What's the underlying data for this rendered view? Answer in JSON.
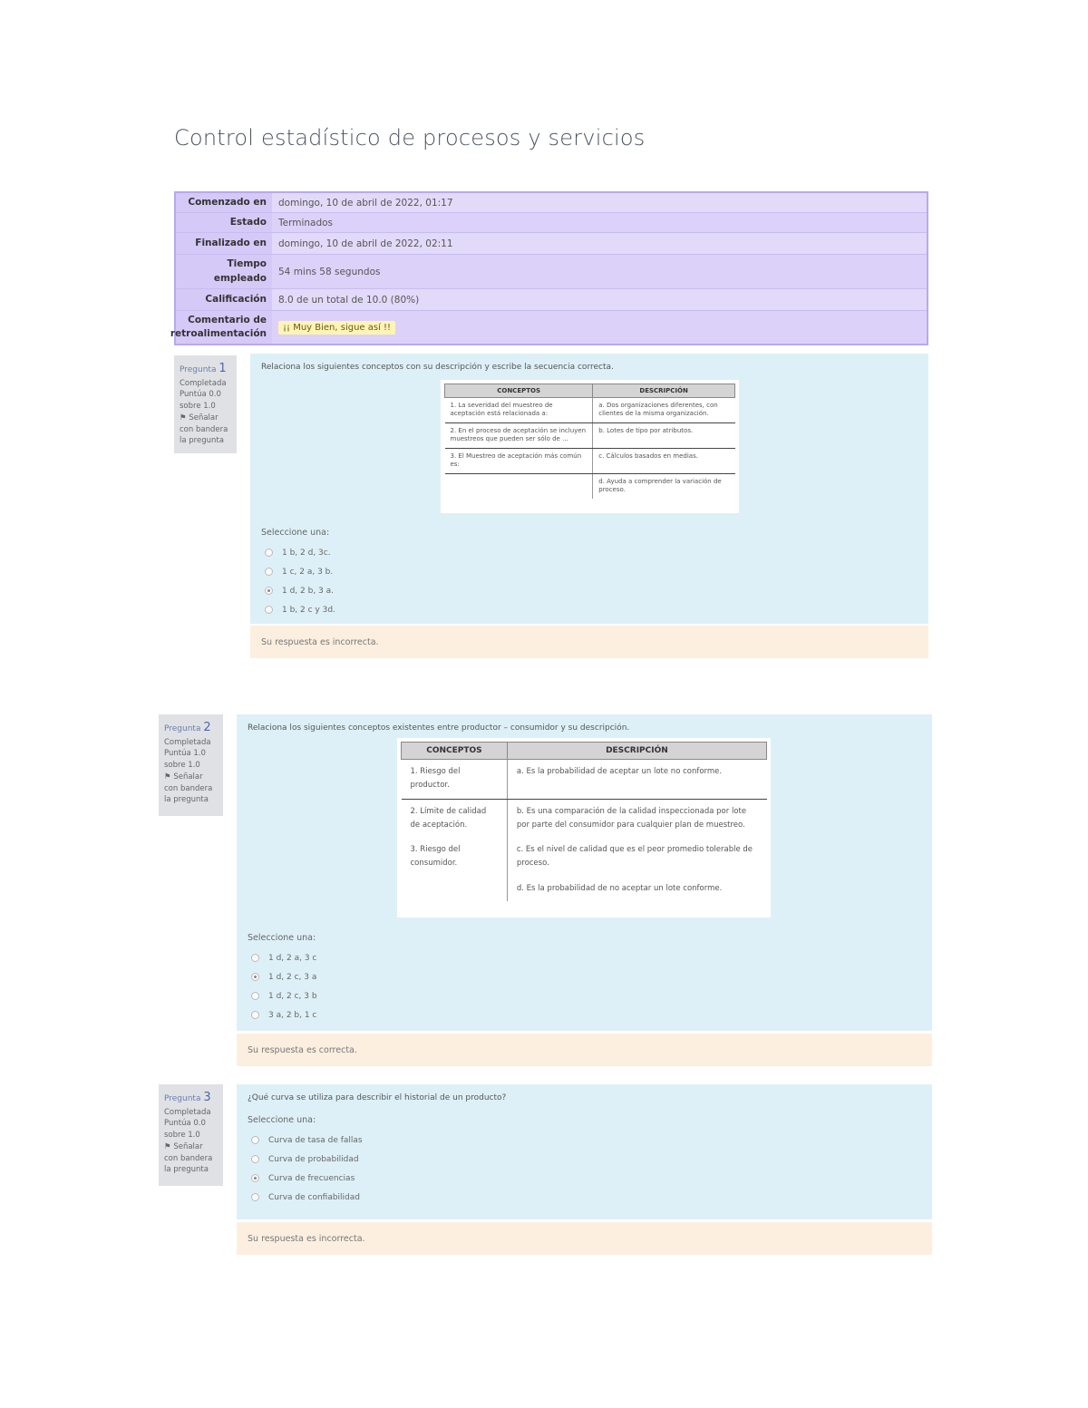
{
  "page_title": "Control estadístico de procesos y servicios",
  "summary": [
    {
      "label": "Comenzado en",
      "value": "domingo, 10 de abril de 2022, 01:17"
    },
    {
      "label": "Estado",
      "value": "Terminados"
    },
    {
      "label": "Finalizado en",
      "value": "domingo, 10 de abril de 2022, 02:11"
    },
    {
      "label": "Tiempo empleado",
      "value": "54 mins 58 segundos"
    },
    {
      "label": "Calificación",
      "value": "8.0 de un total de 10.0 (80%)"
    },
    {
      "label": "Comentario de retroalimentación",
      "value": "¡¡ Muy Bien, sigue así !!"
    }
  ],
  "questions": [
    {
      "number_prefix": "Pregunta",
      "number": "1",
      "state": "Completada",
      "score": "Puntúa 0.0 sobre 1.0",
      "flag": "Señalar con bandera la pregunta",
      "prompt": "Relaciona los siguientes conceptos con su descripción y escribe la secuencia correcta.",
      "table": {
        "headers": [
          "CONCEPTOS",
          "DESCRIPCIÓN"
        ],
        "rows": [
          [
            "1. La severidad del muestreo de aceptación está relacionada a:",
            "a. Dos organizaciones diferentes, con clientes de la misma organización."
          ],
          [
            "2. En el proceso de aceptación se incluyen muestreos que pueden ser sólo de ...",
            "b. Lotes de tipo por atributos."
          ],
          [
            "3. El Muestreo de aceptación más común es:",
            "c. Cálculos basados en medias."
          ],
          [
            "",
            "d. Ayuda a comprender la variación de proceso."
          ]
        ]
      },
      "select_label": "Seleccione una:",
      "options": [
        "1 b, 2 d, 3c.",
        "1 c, 2 a, 3 b.",
        "1 d, 2 b, 3 a.",
        "1 b, 2 c y 3d."
      ],
      "selected": 2,
      "feedback": "Su respuesta es incorrecta."
    },
    {
      "number_prefix": "Pregunta",
      "number": "2",
      "state": "Completada",
      "score": "Puntúa 1.0 sobre 1.0",
      "flag": "Señalar con bandera la pregunta",
      "prompt": "Relaciona los siguientes conceptos existentes entre productor – consumidor y su descripción.",
      "table": {
        "headers": [
          "CONCEPTOS",
          "DESCRIPCIÓN"
        ],
        "rows": [
          [
            "1. Riesgo del productor.",
            "a. Es la probabilidad de aceptar un lote no conforme."
          ],
          [
            "2. Límite de calidad de aceptación.",
            "b. Es una comparación de la calidad inspeccionada por lote por parte del consumidor para cualquier plan de muestreo."
          ],
          [
            "3. Riesgo del consumidor.",
            "c. Es el nivel de calidad que es el peor promedio tolerable de proceso."
          ],
          [
            "",
            "d. Es la probabilidad de no aceptar un lote conforme."
          ]
        ]
      },
      "select_label": "Seleccione una:",
      "options": [
        "1 d, 2 a, 3 c",
        "1 d, 2 c, 3 a",
        "1 d, 2 c, 3 b",
        "3 a, 2 b, 1 c"
      ],
      "selected": 1,
      "feedback": "Su respuesta es correcta."
    },
    {
      "number_prefix": "Pregunta",
      "number": "3",
      "state": "Completada",
      "score": "Puntúa 0.0 sobre 1.0",
      "flag": "Señalar con bandera la pregunta",
      "prompt": "¿Qué curva se utiliza para describir el historial de un producto?",
      "select_label": "Seleccione una:",
      "options": [
        "Curva de tasa de fallas",
        "Curva de probabilidad",
        "Curva de frecuencias",
        "Curva de confiabilidad"
      ],
      "selected": 2,
      "feedback": "Su respuesta es incorrecta."
    }
  ]
}
